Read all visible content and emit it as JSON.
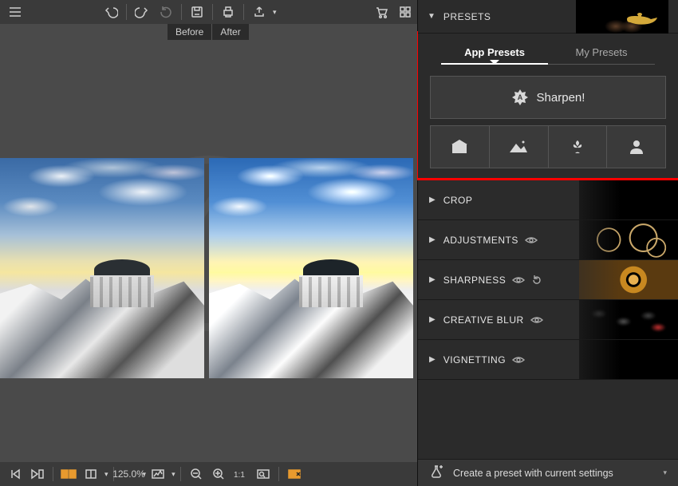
{
  "toolbar": {
    "menu": "≡",
    "undo": "↶",
    "redo": "↷",
    "redo2": "↻",
    "save": "💾",
    "print": "🖨",
    "share": "↗",
    "cart": "🛒",
    "grid": "▦"
  },
  "compare": {
    "before": "Before",
    "after": "After"
  },
  "bottom": {
    "zoom_value": "125.0%"
  },
  "sidebar": {
    "presets_title": "PRESETS",
    "tabs": {
      "app": "App Presets",
      "my": "My Presets"
    },
    "hero": "Sharpen!",
    "sections": [
      {
        "label": "CROP",
        "eye": false,
        "reset": false
      },
      {
        "label": "ADJUSTMENTS",
        "eye": true,
        "reset": false
      },
      {
        "label": "SHARPNESS",
        "eye": true,
        "reset": true
      },
      {
        "label": "CREATIVE BLUR",
        "eye": true,
        "reset": false
      },
      {
        "label": "VIGNETTING",
        "eye": true,
        "reset": false
      }
    ],
    "create": "Create a preset with current settings"
  }
}
